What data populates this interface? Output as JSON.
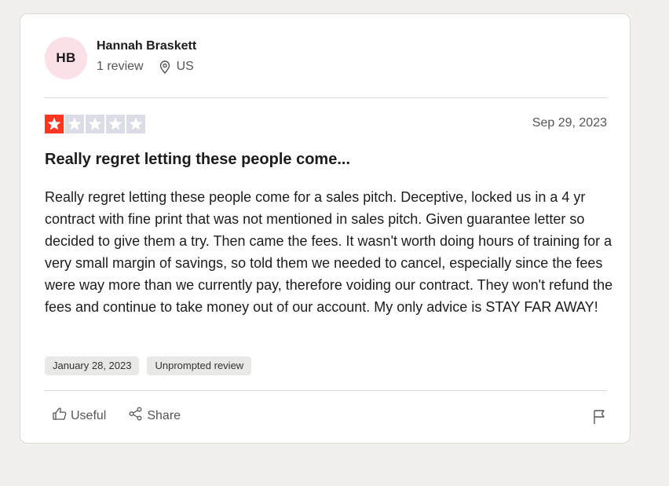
{
  "reviewer": {
    "initials": "HB",
    "name": "Hannah Braskett",
    "review_count": "1 review",
    "country": "US"
  },
  "review": {
    "rating": 1,
    "max_rating": 5,
    "date": "Sep 29, 2023",
    "title": "Really regret letting these people come...",
    "body": "Really regret letting these people come for a sales pitch. Deceptive, locked us in a 4 yr contract with fine print that was not mentioned in sales pitch. Given guarantee letter so decided to give them a try. Then came the fees. It wasn't worth doing hours of training for a very small margin of savings, so told them we needed to cancel, especially since the fees were way more than we currently pay, therefore voiding our contract. They won't refund the fees and continue to take money out of our account. My only advice is STAY FAR AWAY!",
    "tags": [
      "January 28, 2023",
      "Unprompted review"
    ]
  },
  "actions": {
    "useful_label": "Useful",
    "share_label": "Share"
  },
  "colors": {
    "star_filled": "#ff3722",
    "star_empty": "#dcdce6",
    "avatar_bg": "#fce0e8"
  },
  "icons": {
    "location": "map-pin-icon",
    "useful": "thumbs-up-icon",
    "share": "share-icon",
    "report": "flag-icon"
  }
}
